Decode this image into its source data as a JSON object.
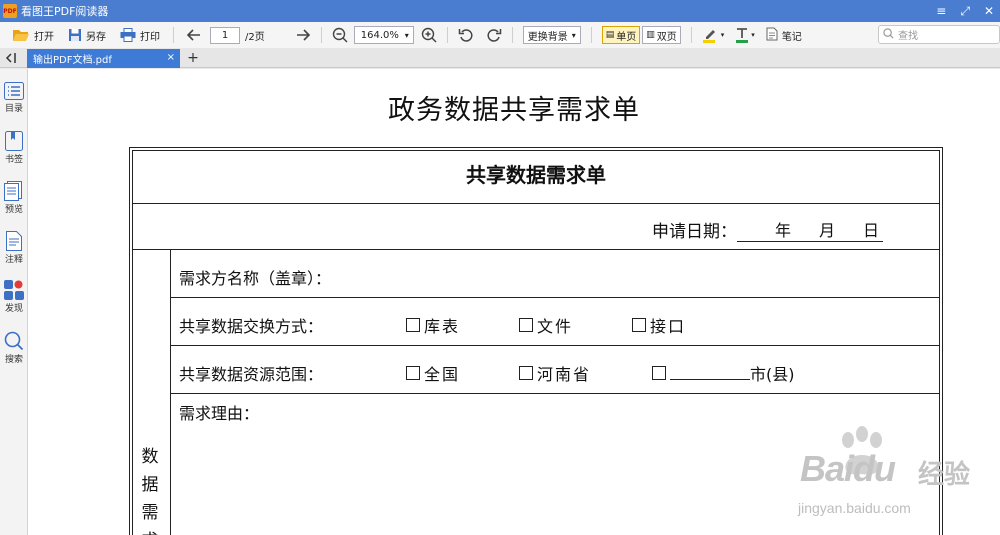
{
  "titlebar": {
    "app_title": "看图王PDF阅读器",
    "logo_text": "PDF"
  },
  "toolbar": {
    "open": "打开",
    "save_as": "另存",
    "print": "打印",
    "page_current": "1",
    "page_total": "/2页",
    "zoom": "164.0%",
    "background": "更换背景",
    "single_page": "单页",
    "double_page": "双页",
    "notes": "笔记",
    "search_placeholder": "查找"
  },
  "tabs": {
    "active_tab": "输出PDF文档.pdf",
    "close": "×",
    "add": "+"
  },
  "sidebar": {
    "items": [
      {
        "label": "目录",
        "icon": "list-icon"
      },
      {
        "label": "书签",
        "icon": "bookmark-icon"
      },
      {
        "label": "预览",
        "icon": "thumbnail-icon"
      },
      {
        "label": "注释",
        "icon": "annotation-icon"
      },
      {
        "label": "发现",
        "icon": "discover-icon"
      },
      {
        "label": "搜索",
        "icon": "search-icon"
      }
    ]
  },
  "document": {
    "title": "政务数据共享需求单",
    "table_title": "共享数据需求单",
    "date_label": "申请日期：",
    "date_year": "年",
    "date_month": "月",
    "date_day": "日",
    "rows": {
      "requester": "需求方名称（盖章）：",
      "exchange_mode": "共享数据交换方式：",
      "resource_scope": "共享数据资源范围：",
      "reason": "需求理由："
    },
    "exchange_options": [
      "库表",
      "文件",
      "接口"
    ],
    "scope_options": [
      "全国",
      "河南省",
      "市(县)"
    ],
    "side_label": [
      "数",
      "据",
      "需",
      "求"
    ]
  },
  "watermark": {
    "brand": "Baidu",
    "cn": "经验",
    "url": "jingyan.baidu.com"
  },
  "colors": {
    "titlebar": "#4a7dcf",
    "active_tab": "#3e7bd6",
    "active_view": "#fff3c0"
  }
}
